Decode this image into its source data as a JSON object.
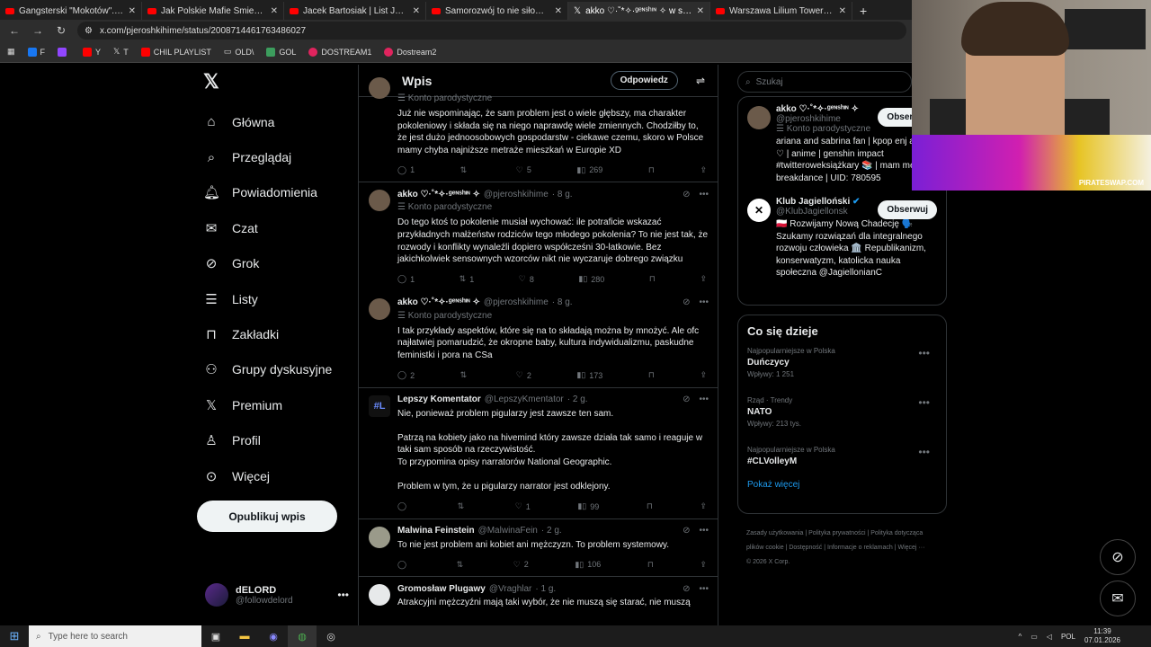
{
  "browser": {
    "tabs": [
      {
        "title": "Gangsterski \"Mokotów\". Szlak p",
        "kind": "yt",
        "active": false
      },
      {
        "title": "Jak Polskie Mafie Śmieciowe TR",
        "kind": "yt",
        "active": false
      },
      {
        "title": "Jacek Bartosiak | List Józefa Pił",
        "kind": "yt",
        "active": false
      },
      {
        "title": "Samorozwój to nie siłownia, a w",
        "kind": "yt",
        "active": false
      },
      {
        "title": "akko ♡·˚*✧·ᵍᵉᶰˢʰᶦᶰ ✧ w serwisie",
        "kind": "x",
        "active": true
      },
      {
        "title": "Warszawa Lilium Tower będzie",
        "kind": "yt",
        "active": false
      }
    ],
    "url": "x.com/pjeroshkihime/status/2008714461763486027",
    "bookmarks": [
      "F",
      "",
      "Y",
      "T",
      "CHIL PLAYLIST",
      "OLD\\",
      "GOL",
      "DOSTREAM1",
      "Dostream2"
    ]
  },
  "nav": {
    "items": [
      "Główna",
      "Przeglądaj",
      "Powiadomienia",
      "Czat",
      "Grok",
      "Listy",
      "Zakładki",
      "Grupy dyskusyjne",
      "Premium",
      "Profil",
      "Więcej"
    ],
    "post_button": "Opublikuj wpis",
    "account_name": "dELORD",
    "account_handle": "@followdelord"
  },
  "header": {
    "title": "Wpis",
    "reply_button": "Odpowiedz"
  },
  "posts": [
    {
      "name": "",
      "handle": "",
      "time": "",
      "parody": "Konto parodystyczne",
      "text": "Już nie wspominając, że sam problem jest o wiele głębszy, ma charakter pokoleniowy i składa się na niego naprawdę wiele zmiennych. Chodziłby to, że jest dużo jednoosobowych gospodarstw - ciekawe czemu, skoro w Polsce mamy chyba najniższe metraże mieszkań w Europie XD",
      "replies": "1",
      "reposts": "",
      "likes": "5",
      "views": "269"
    },
    {
      "name": "akko ♡·˚*✧·ᵍᵉᶰˢʰᶦᶰ ✧",
      "handle": "@pjeroshkihime",
      "time": "· 8 g.",
      "parody": "Konto parodystyczne",
      "text": "Do tego ktoś to pokolenie musiał wychować: ile potraficie wskazać przykładnych małżeństw rodziców tego młodego pokolenia? To nie jest tak, że rozwody i konflikty wynaleźli dopiero współcześni 30-latkowie. Bez jakichkolwiek sensownych wzorców nikt nie wyczaruje dobrego związku",
      "replies": "1",
      "reposts": "1",
      "likes": "8",
      "views": "280"
    },
    {
      "name": "akko ♡·˚*✧·ᵍᵉᶰˢʰᶦᶰ ✧",
      "handle": "@pjeroshkihime",
      "time": "· 8 g.",
      "parody": "Konto parodystyczne",
      "text": "I tak przykłady aspektów, które się na to składają można by mnożyć. Ale ofc najłatwiej pomarudzić, że okropne baby, kultura indywidualizmu, paskudne feministki i pora na CSa",
      "replies": "2",
      "reposts": "",
      "likes": "2",
      "views": "173"
    },
    {
      "name": "Lepszy Komentator",
      "handle": "@LepszyKmentator",
      "time": "· 2 g.",
      "parody": "",
      "text": "Nie, ponieważ problem pigularzy jest zawsze ten sam.\n\nPatrzą na kobiety jako na hivemind który zawsze działa tak samo i reaguje w taki sam sposób na rzeczywistość.\nTo przypomina opisy narratorów National Geographic.\n\nProblem w tym, że u pigularzy narrator jest odklejony.",
      "replies": "",
      "reposts": "",
      "likes": "1",
      "views": "99"
    },
    {
      "name": "Malwina Feinstein",
      "handle": "@MalwinaFein",
      "time": "· 2 g.",
      "parody": "",
      "text": "To nie jest problem ani kobiet ani mężczyzn. To problem systemowy.",
      "replies": "",
      "reposts": "",
      "likes": "2",
      "views": "106"
    },
    {
      "name": "Gromosław Plugawy",
      "handle": "@Vraghlar",
      "time": "· 1 g.",
      "parody": "",
      "text": "Atrakcyjni mężczyźni mają taki wybór, że nie muszą się starać, nie muszą",
      "replies": "",
      "reposts": "",
      "likes": "",
      "views": ""
    }
  ],
  "right": {
    "search_placeholder": "Szukaj",
    "suggest": [
      {
        "name": "akko ♡·˚*✧·ᵍᵉᶰˢʰᶦᶰ ✧",
        "handle": "@pjeroshkihime",
        "parody": "Konto parodystyczne",
        "bio": "ariana and sabrina fan | kpop enj aespa ♡ | anime | genshin impact #twitteroweksiążkary 📚 | mam mental breakdance | UID: 780595",
        "follow": "Obserwuj"
      },
      {
        "name": "Klub Jagielloński",
        "handle": "@KlubJagiellonsk",
        "parody": "",
        "bio": "🇵🇱 Rozwijamy Nową Chadecję 🗣️ Szukamy rozwiązań dla integralnego rozwoju człowieka 🏛️ Republikanizm, konserwatyzm, katolicka nauka społeczna @JagiellonianC",
        "follow": "Obserwuj"
      }
    ],
    "trends_title": "Co się dzieje",
    "trends": [
      {
        "category": "Najpopularniejsze w Polska",
        "name": "Duńczycy",
        "count": "Wpływy: 1 251"
      },
      {
        "category": "Rząd · Trendy",
        "name": "NATO",
        "count": "Wpływy: 213 tys."
      },
      {
        "category": "Najpopularniejsze w Polska",
        "name": "#CLVolleyM",
        "count": ""
      }
    ],
    "show_more": "Pokaż więcej",
    "footer": "Zasady użytkowania | Polityka prywatności | Polityka dotycząca plików cookie | Dostępność | Informacje o reklamach | Więcej ··· © 2026 X Corp."
  },
  "webcam": {
    "brand": "PIRATESWAP.COM"
  },
  "taskbar": {
    "search_placeholder": "Type here to search",
    "lang": "POL",
    "time": "11:39",
    "date": "07.01.2026"
  }
}
